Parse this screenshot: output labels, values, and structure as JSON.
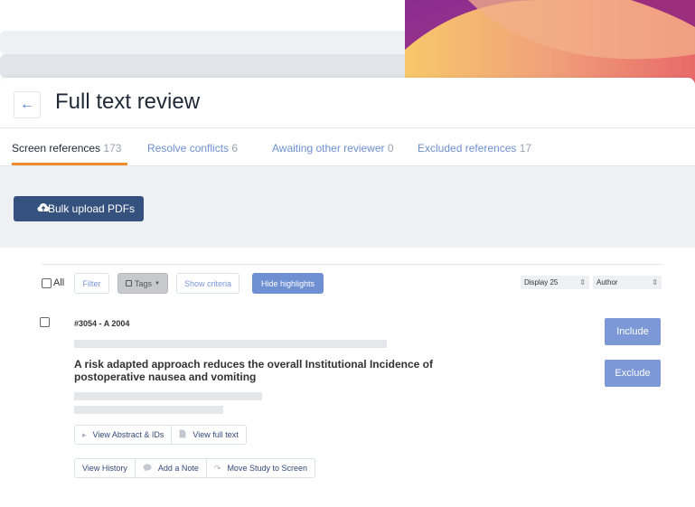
{
  "page": {
    "title": "Full text review",
    "back_icon": "arrow-left-icon"
  },
  "tabs": [
    {
      "label": "Screen references",
      "count": "173",
      "active": true
    },
    {
      "label": "Resolve conflicts",
      "count": "6",
      "active": false
    },
    {
      "label": "Awaiting other reviewer",
      "count": "0",
      "active": false
    },
    {
      "label": "Excluded references",
      "count": "17",
      "active": false
    }
  ],
  "upload": {
    "button_label": "Bulk upload PDFs",
    "icon": "cloud-upload-icon"
  },
  "toolbar": {
    "all_label": "All",
    "filter_label": "Filter",
    "tags_label": "Tags",
    "show_criteria_label": "Show criteria",
    "hide_highlights_label": "Hide highlights",
    "display_label": "Display 25",
    "sort_label": "Author"
  },
  "study": {
    "ref_id": "#3054 - A 2004",
    "title": "A risk adapted approach reduces the overall Institutional Incidence of postoperative nausea and vomiting",
    "include_label": "Include",
    "exclude_label": "Exclude",
    "actions_row1": [
      {
        "label": "View Abstract & IDs",
        "icon": "caret-right-icon"
      },
      {
        "label": "View full text",
        "icon": "document-icon"
      }
    ],
    "actions_row2": [
      {
        "label": "View History",
        "icon": ""
      },
      {
        "label": "Add a Note",
        "icon": "comment-icon"
      },
      {
        "label": "Move Study to Screen",
        "icon": "redo-icon"
      }
    ]
  },
  "colors": {
    "accent_tab": "#ec8c2c",
    "primary_dark": "#34527d",
    "primary_light": "#7c98d6"
  }
}
